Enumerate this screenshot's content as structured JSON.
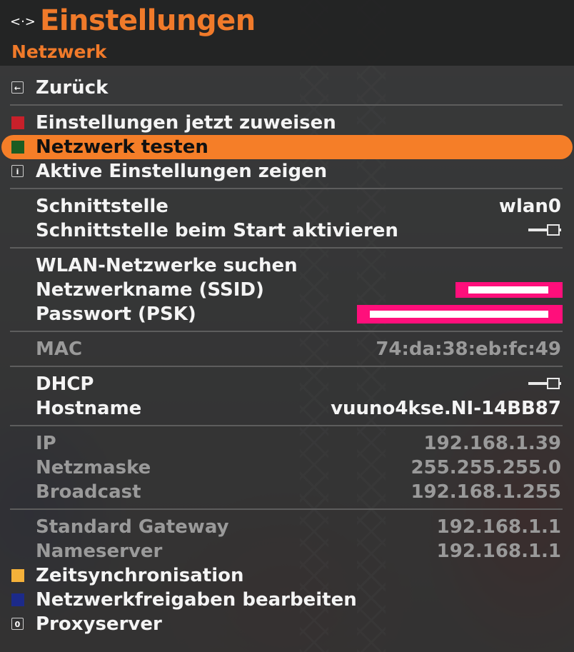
{
  "header": {
    "title": "Einstellungen",
    "subtitle": "Netzwerk",
    "icon": "move-icon"
  },
  "menu": {
    "back": "Zurück",
    "apply": "Einstellungen jetzt zuweisen",
    "test": "Netzwerk testen",
    "show_active": "Aktive Einstellungen zeigen"
  },
  "interface": {
    "label": "Schnittstelle",
    "value": "wlan0",
    "on_start_label": "Schnittstelle beim Start aktivieren"
  },
  "wlan": {
    "search": "WLAN-Netzwerke suchen",
    "ssid_label": "Netzwerkname (SSID)",
    "psk_label": "Passwort (PSK)"
  },
  "mac": {
    "label": "MAC",
    "value": "74:da:38:eb:fc:49"
  },
  "dhcp": {
    "label": "DHCP",
    "hostname_label": "Hostname",
    "hostname_value": "vuuno4kse.NI-14BB87"
  },
  "ip": {
    "ip_label": "IP",
    "ip_value": "192.168.1.39",
    "mask_label": "Netzmaske",
    "mask_value": "255.255.255.0",
    "bcast_label": "Broadcast",
    "bcast_value": "192.168.1.255"
  },
  "gateway": {
    "gw_label": "Standard Gateway",
    "gw_value": "192.168.1.1",
    "ns_label": "Nameserver",
    "ns_value": "192.168.1.1"
  },
  "extra": {
    "timesync": "Zeitsynchronisation",
    "shares": "Netzwerkfreigaben bearbeiten",
    "proxy": "Proxyserver"
  },
  "colors": {
    "accent": "#f07a2a",
    "highlight": "#f57e28",
    "red_key": "#c8202a",
    "green_key": "#1c5c22",
    "yellow_key": "#f5b13a",
    "blue_key": "#1c2a8a",
    "redaction": "#ff0f7b"
  },
  "keys": {
    "back": "back-arrow-icon",
    "info": "i",
    "zero": "0"
  }
}
